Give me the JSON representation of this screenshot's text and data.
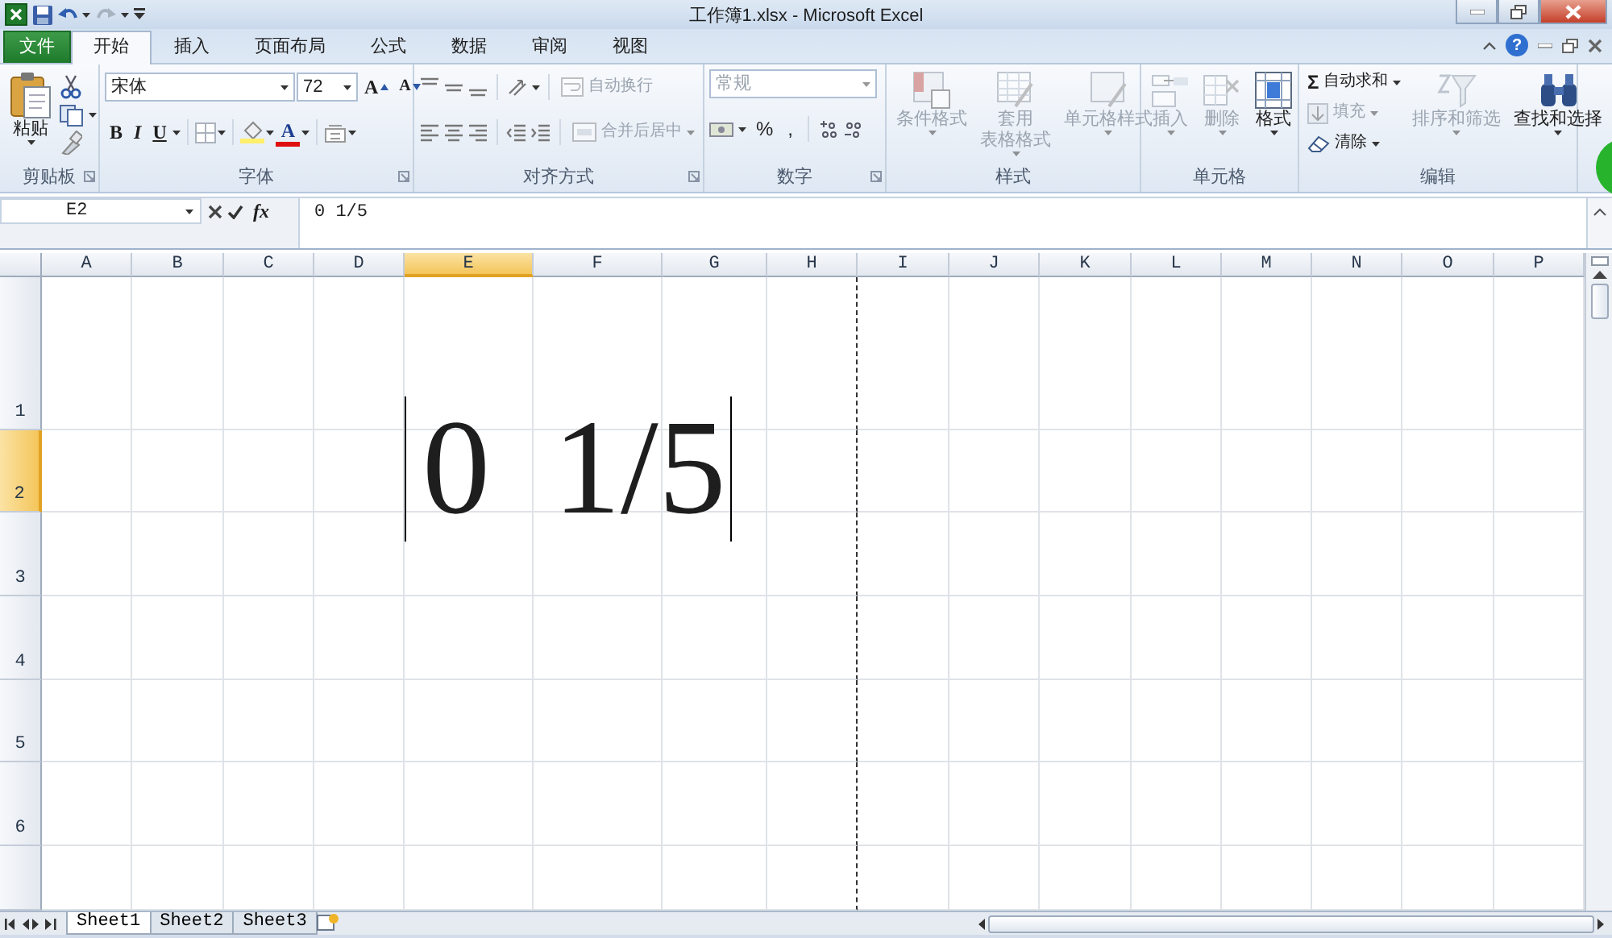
{
  "window": {
    "title": "工作簿1.xlsx - Microsoft Excel",
    "help": "?"
  },
  "tabs": [
    {
      "label": "文件",
      "kind": "file",
      "selected": false
    },
    {
      "label": "开始",
      "kind": "tab",
      "selected": true
    },
    {
      "label": "插入",
      "kind": "tab",
      "selected": false
    },
    {
      "label": "页面布局",
      "kind": "tab",
      "selected": false
    },
    {
      "label": "公式",
      "kind": "tab",
      "selected": false
    },
    {
      "label": "数据",
      "kind": "tab",
      "selected": false
    },
    {
      "label": "审阅",
      "kind": "tab",
      "selected": false
    },
    {
      "label": "视图",
      "kind": "tab",
      "selected": false
    }
  ],
  "ribbon": {
    "clipboard": {
      "label": "剪贴板",
      "paste": "粘贴"
    },
    "font": {
      "label": "字体",
      "font_name": "宋体",
      "font_size": "72",
      "grow": "A",
      "shrink": "A",
      "bold": "B",
      "italic": "I",
      "underline": "U",
      "font_color": "A"
    },
    "alignment": {
      "label": "对齐方式",
      "wrap_text": {
        "label": "自动换行",
        "disabled": true
      },
      "merge": {
        "label": "合并后居中",
        "disabled": true
      }
    },
    "number": {
      "label": "数字",
      "format": {
        "value": "常规",
        "disabled": true
      },
      "percent": "%",
      "comma": ","
    },
    "styles": {
      "label": "样式",
      "items": [
        {
          "lines": [
            "条件格式"
          ],
          "disabled": true
        },
        {
          "lines": [
            "套用",
            "表格格式"
          ],
          "disabled": true
        },
        {
          "lines": [
            "单元格样式"
          ],
          "disabled": true
        }
      ]
    },
    "cells": {
      "label": "单元格",
      "items": [
        {
          "lines": [
            "插入"
          ],
          "disabled": true
        },
        {
          "lines": [
            "删除"
          ],
          "disabled": true
        },
        {
          "lines": [
            "格式"
          ],
          "disabled": false
        }
      ]
    },
    "editing": {
      "label": "编辑",
      "small": [
        {
          "symbol": "Σ",
          "label": "自动求和",
          "disabled": false
        },
        {
          "label": "填充",
          "disabled": true
        },
        {
          "label": "清除",
          "disabled": false
        }
      ],
      "large": [
        {
          "lines": [
            "排序和筛选"
          ],
          "disabled": true
        },
        {
          "lines": [
            "查找和选择"
          ],
          "disabled": false
        }
      ]
    }
  },
  "formula_bar": {
    "name_box": "E2",
    "fx": "fx",
    "content": "0 1/5"
  },
  "sheet": {
    "columns": [
      {
        "label": "A",
        "selected": false
      },
      {
        "label": "B",
        "selected": false
      },
      {
        "label": "C",
        "selected": false
      },
      {
        "label": "D",
        "selected": false
      },
      {
        "label": "E",
        "selected": true
      },
      {
        "label": "F",
        "selected": false
      },
      {
        "label": "G",
        "selected": false
      },
      {
        "label": "H",
        "selected": false
      },
      {
        "label": "I",
        "selected": false
      },
      {
        "label": "J",
        "selected": false
      },
      {
        "label": "K",
        "selected": false
      },
      {
        "label": "L",
        "selected": false
      },
      {
        "label": "M",
        "selected": false
      },
      {
        "label": "N",
        "selected": false
      },
      {
        "label": "O",
        "selected": false
      },
      {
        "label": "P",
        "selected": false
      }
    ],
    "rows": [
      {
        "label": "1",
        "selected": false
      },
      {
        "label": "2",
        "selected": true
      },
      {
        "label": "3",
        "selected": false
      },
      {
        "label": "4",
        "selected": false
      },
      {
        "label": "5",
        "selected": false
      },
      {
        "label": "6",
        "selected": false
      }
    ],
    "editing_cell": {
      "text": "0 1/5"
    }
  },
  "sheet_tabs": [
    {
      "label": "Sheet1",
      "selected": true
    },
    {
      "label": "Sheet2",
      "selected": false
    },
    {
      "label": "Sheet3",
      "selected": false
    }
  ]
}
